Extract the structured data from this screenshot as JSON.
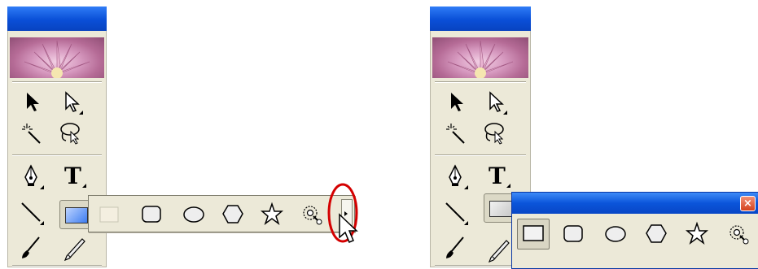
{
  "left_panel": {
    "tools": [
      {
        "name": "selection-tool-icon"
      },
      {
        "name": "direct-selection-tool-icon"
      },
      {
        "name": "magic-wand-tool-icon"
      },
      {
        "name": "lasso-tool-icon"
      },
      {
        "name": "pen-tool-icon"
      },
      {
        "name": "type-tool-icon",
        "label": "T"
      },
      {
        "name": "line-segment-tool-icon"
      },
      {
        "name": "rectangle-tool-icon"
      },
      {
        "name": "paintbrush-tool-icon"
      },
      {
        "name": "pencil-tool-icon"
      }
    ]
  },
  "flyout": {
    "tools": [
      {
        "name": "rectangle-tool"
      },
      {
        "name": "rounded-rectangle-tool"
      },
      {
        "name": "ellipse-tool"
      },
      {
        "name": "polygon-tool"
      },
      {
        "name": "star-tool"
      },
      {
        "name": "flare-tool"
      }
    ],
    "tearoff": "tearoff-arrow"
  },
  "floating_window": {
    "close_label": "×"
  },
  "colors": {
    "titlebar": "#0a4fd7",
    "panel_bg": "#ece9d8",
    "highlight": "#d40000"
  }
}
